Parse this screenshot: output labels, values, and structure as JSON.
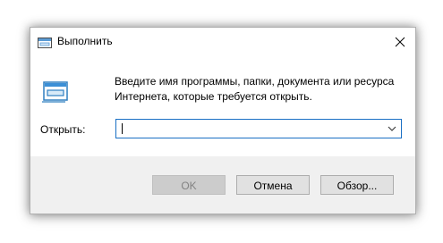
{
  "window": {
    "title": "Выполнить",
    "icon": "run-icon",
    "close_icon": "close-icon"
  },
  "content": {
    "description": "Введите имя программы, папки, документа или ресурса Интернета, которые требуется открыть.",
    "open_label": "Открыть:",
    "input_value": "",
    "dropdown_icon": "chevron-down-icon"
  },
  "buttons": {
    "ok": "OK",
    "cancel": "Отмена",
    "browse": "Обзор..."
  },
  "colors": {
    "focus_border": "#1a6fc4",
    "footer_bg": "#f0f0f0"
  }
}
